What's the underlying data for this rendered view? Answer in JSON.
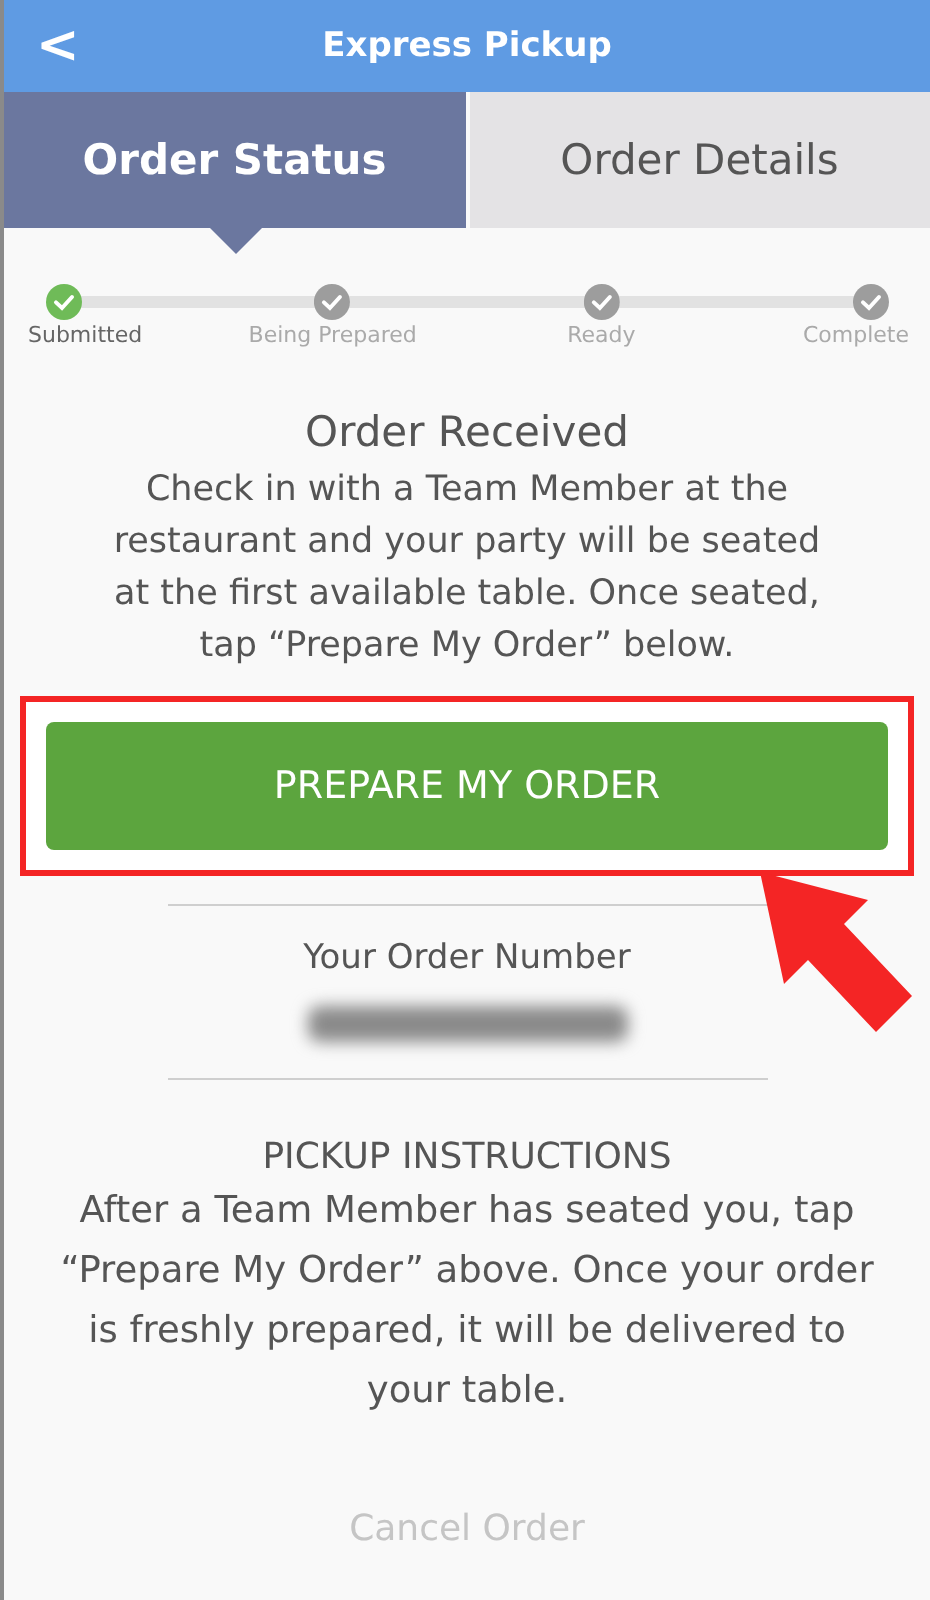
{
  "header": {
    "back": "<",
    "title": "Express Pickup"
  },
  "tabs": [
    {
      "label": "Order Status",
      "selected": true
    },
    {
      "label": "Order Details",
      "selected": false
    }
  ],
  "steps": [
    {
      "label": "Submitted",
      "done": true
    },
    {
      "label": "Being Prepared",
      "done": false
    },
    {
      "label": "Ready",
      "done": false
    },
    {
      "label": "Complete",
      "done": false
    }
  ],
  "status": {
    "title": "Order Received",
    "message": "Check in with a Team Member at the restaurant and your party will be seated at the first available table. Once seated, tap “Prepare My Order” below."
  },
  "primary_button": {
    "label": "PREPARE MY ORDER",
    "highlighted": true
  },
  "order_number": {
    "label": "Your Order Number",
    "blurred": true
  },
  "instructions": {
    "title": "PICKUP INSTRUCTIONS",
    "text": "After a Team Member has seated you, tap “Prepare My Order” above.  Once your order is freshly prepared, it will be delivered to your table."
  },
  "cancel": "Cancel Order"
}
